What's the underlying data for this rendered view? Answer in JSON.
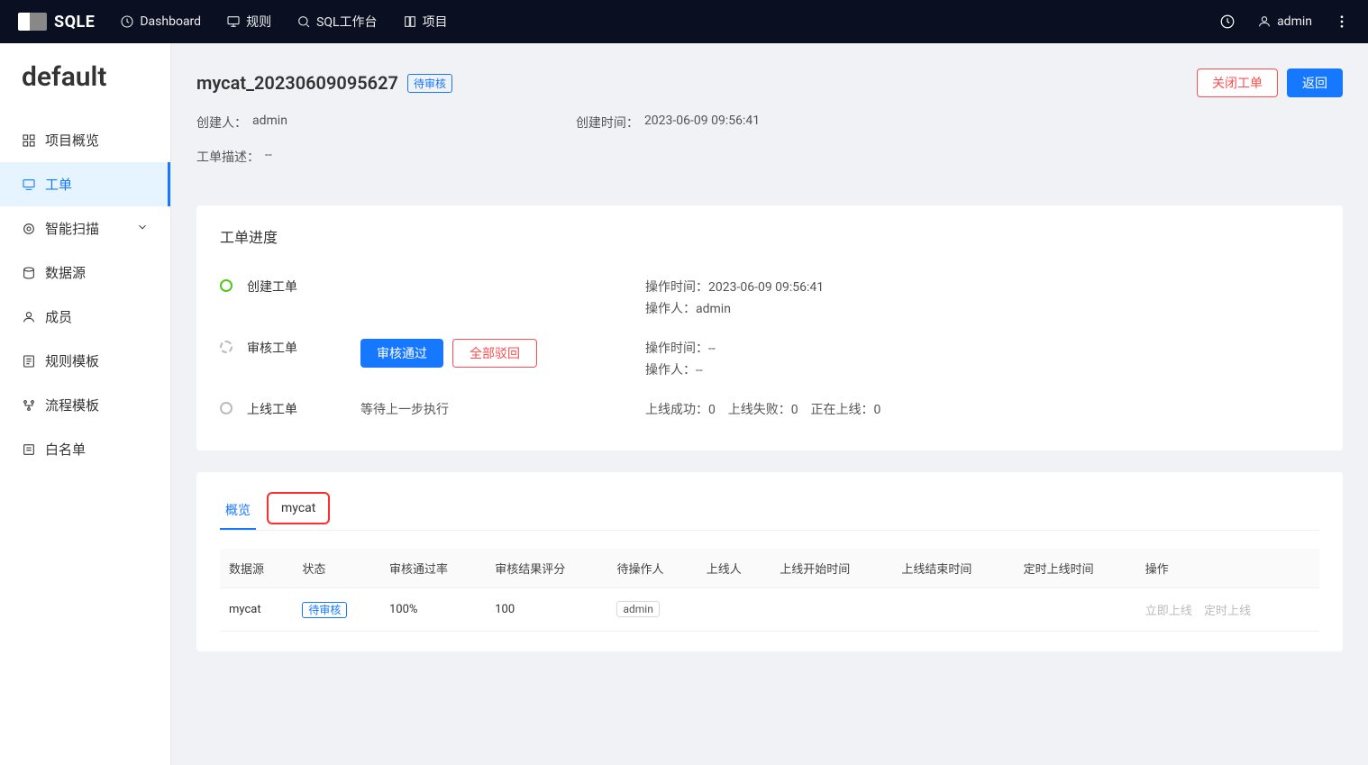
{
  "brand": "SQLE",
  "topnav": {
    "dashboard": "Dashboard",
    "rules": "规则",
    "sql_workspace": "SQL工作台",
    "projects": "项目"
  },
  "user": {
    "name": "admin"
  },
  "project": "default",
  "sidebar": {
    "overview": "项目概览",
    "orders": "工单",
    "scan": "智能扫描",
    "datasource": "数据源",
    "members": "成员",
    "rule_templates": "规则模板",
    "workflow_templates": "流程模板",
    "whitelist": "白名单"
  },
  "page": {
    "title": "mycat_20230609095627",
    "status_badge": "待审核",
    "close_btn": "关闭工单",
    "back_btn": "返回",
    "creator_label": "创建人：",
    "creator": "admin",
    "created_at_label": "创建时间：",
    "created_at": "2023-06-09 09:56:41",
    "desc_label": "工单描述：",
    "desc": "--"
  },
  "progress": {
    "title": "工单进度",
    "step1": {
      "label": "创建工单",
      "op_time_label": "操作时间：",
      "op_time": "2023-06-09 09:56:41",
      "operator_label": "操作人：",
      "operator": "admin"
    },
    "step2": {
      "label": "审核工单",
      "approve_btn": "审核通过",
      "reject_btn": "全部驳回",
      "op_time_label": "操作时间：",
      "op_time": "--",
      "operator_label": "操作人：",
      "operator": "--"
    },
    "step3": {
      "label": "上线工单",
      "waiting": "等待上一步执行",
      "success_label": "上线成功：",
      "success": "0",
      "fail_label": "上线失败：",
      "fail": "0",
      "running_label": "正在上线：",
      "running": "0"
    }
  },
  "tabs": {
    "overview": "概览",
    "mycat": "mycat"
  },
  "table": {
    "headers": {
      "datasource": "数据源",
      "status": "状态",
      "pass_rate": "审核通过率",
      "score": "审核结果评分",
      "pending_operator": "待操作人",
      "executor": "上线人",
      "start": "上线开始时间",
      "end": "上线结束时间",
      "scheduled": "定时上线时间",
      "operations": "操作"
    },
    "row": {
      "datasource": "mycat",
      "status": "待审核",
      "pass_rate": "100%",
      "score": "100",
      "pending_operator": "admin",
      "op_immediate": "立即上线",
      "op_schedule": "定时上线"
    }
  }
}
